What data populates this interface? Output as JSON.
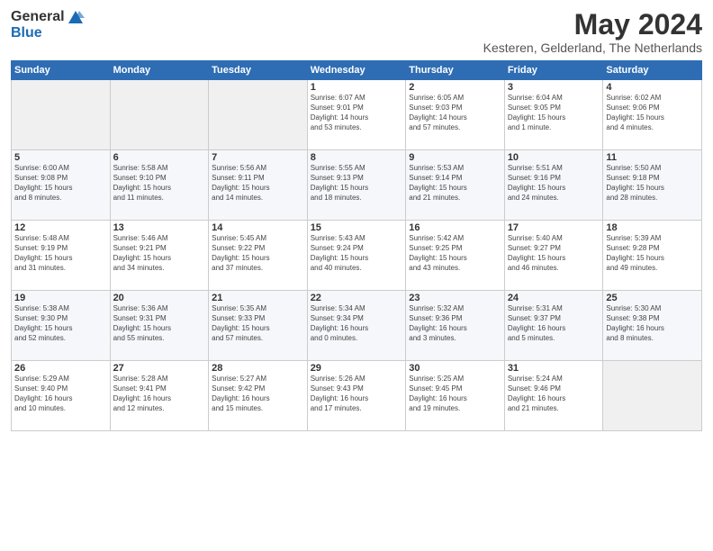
{
  "logo": {
    "general": "General",
    "blue": "Blue"
  },
  "title": "May 2024",
  "location": "Kesteren, Gelderland, The Netherlands",
  "days_of_week": [
    "Sunday",
    "Monday",
    "Tuesday",
    "Wednesday",
    "Thursday",
    "Friday",
    "Saturday"
  ],
  "weeks": [
    [
      {
        "day": "",
        "info": ""
      },
      {
        "day": "",
        "info": ""
      },
      {
        "day": "",
        "info": ""
      },
      {
        "day": "1",
        "info": "Sunrise: 6:07 AM\nSunset: 9:01 PM\nDaylight: 14 hours\nand 53 minutes."
      },
      {
        "day": "2",
        "info": "Sunrise: 6:05 AM\nSunset: 9:03 PM\nDaylight: 14 hours\nand 57 minutes."
      },
      {
        "day": "3",
        "info": "Sunrise: 6:04 AM\nSunset: 9:05 PM\nDaylight: 15 hours\nand 1 minute."
      },
      {
        "day": "4",
        "info": "Sunrise: 6:02 AM\nSunset: 9:06 PM\nDaylight: 15 hours\nand 4 minutes."
      }
    ],
    [
      {
        "day": "5",
        "info": "Sunrise: 6:00 AM\nSunset: 9:08 PM\nDaylight: 15 hours\nand 8 minutes."
      },
      {
        "day": "6",
        "info": "Sunrise: 5:58 AM\nSunset: 9:10 PM\nDaylight: 15 hours\nand 11 minutes."
      },
      {
        "day": "7",
        "info": "Sunrise: 5:56 AM\nSunset: 9:11 PM\nDaylight: 15 hours\nand 14 minutes."
      },
      {
        "day": "8",
        "info": "Sunrise: 5:55 AM\nSunset: 9:13 PM\nDaylight: 15 hours\nand 18 minutes."
      },
      {
        "day": "9",
        "info": "Sunrise: 5:53 AM\nSunset: 9:14 PM\nDaylight: 15 hours\nand 21 minutes."
      },
      {
        "day": "10",
        "info": "Sunrise: 5:51 AM\nSunset: 9:16 PM\nDaylight: 15 hours\nand 24 minutes."
      },
      {
        "day": "11",
        "info": "Sunrise: 5:50 AM\nSunset: 9:18 PM\nDaylight: 15 hours\nand 28 minutes."
      }
    ],
    [
      {
        "day": "12",
        "info": "Sunrise: 5:48 AM\nSunset: 9:19 PM\nDaylight: 15 hours\nand 31 minutes."
      },
      {
        "day": "13",
        "info": "Sunrise: 5:46 AM\nSunset: 9:21 PM\nDaylight: 15 hours\nand 34 minutes."
      },
      {
        "day": "14",
        "info": "Sunrise: 5:45 AM\nSunset: 9:22 PM\nDaylight: 15 hours\nand 37 minutes."
      },
      {
        "day": "15",
        "info": "Sunrise: 5:43 AM\nSunset: 9:24 PM\nDaylight: 15 hours\nand 40 minutes."
      },
      {
        "day": "16",
        "info": "Sunrise: 5:42 AM\nSunset: 9:25 PM\nDaylight: 15 hours\nand 43 minutes."
      },
      {
        "day": "17",
        "info": "Sunrise: 5:40 AM\nSunset: 9:27 PM\nDaylight: 15 hours\nand 46 minutes."
      },
      {
        "day": "18",
        "info": "Sunrise: 5:39 AM\nSunset: 9:28 PM\nDaylight: 15 hours\nand 49 minutes."
      }
    ],
    [
      {
        "day": "19",
        "info": "Sunrise: 5:38 AM\nSunset: 9:30 PM\nDaylight: 15 hours\nand 52 minutes."
      },
      {
        "day": "20",
        "info": "Sunrise: 5:36 AM\nSunset: 9:31 PM\nDaylight: 15 hours\nand 55 minutes."
      },
      {
        "day": "21",
        "info": "Sunrise: 5:35 AM\nSunset: 9:33 PM\nDaylight: 15 hours\nand 57 minutes."
      },
      {
        "day": "22",
        "info": "Sunrise: 5:34 AM\nSunset: 9:34 PM\nDaylight: 16 hours\nand 0 minutes."
      },
      {
        "day": "23",
        "info": "Sunrise: 5:32 AM\nSunset: 9:36 PM\nDaylight: 16 hours\nand 3 minutes."
      },
      {
        "day": "24",
        "info": "Sunrise: 5:31 AM\nSunset: 9:37 PM\nDaylight: 16 hours\nand 5 minutes."
      },
      {
        "day": "25",
        "info": "Sunrise: 5:30 AM\nSunset: 9:38 PM\nDaylight: 16 hours\nand 8 minutes."
      }
    ],
    [
      {
        "day": "26",
        "info": "Sunrise: 5:29 AM\nSunset: 9:40 PM\nDaylight: 16 hours\nand 10 minutes."
      },
      {
        "day": "27",
        "info": "Sunrise: 5:28 AM\nSunset: 9:41 PM\nDaylight: 16 hours\nand 12 minutes."
      },
      {
        "day": "28",
        "info": "Sunrise: 5:27 AM\nSunset: 9:42 PM\nDaylight: 16 hours\nand 15 minutes."
      },
      {
        "day": "29",
        "info": "Sunrise: 5:26 AM\nSunset: 9:43 PM\nDaylight: 16 hours\nand 17 minutes."
      },
      {
        "day": "30",
        "info": "Sunrise: 5:25 AM\nSunset: 9:45 PM\nDaylight: 16 hours\nand 19 minutes."
      },
      {
        "day": "31",
        "info": "Sunrise: 5:24 AM\nSunset: 9:46 PM\nDaylight: 16 hours\nand 21 minutes."
      },
      {
        "day": "",
        "info": ""
      }
    ]
  ]
}
